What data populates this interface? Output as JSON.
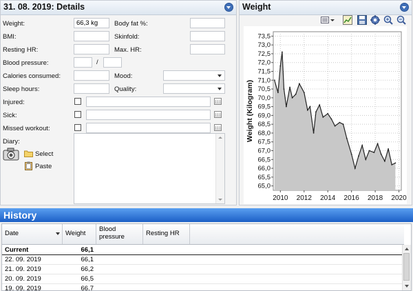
{
  "details": {
    "title": "31. 08. 2019: Details",
    "weight_label": "Weight:",
    "weight_value": "66,3 kg",
    "body_fat_label": "Body fat %:",
    "bmi_label": "BMI:",
    "skinfold_label": "Skinfold:",
    "resting_hr_label": "Resting HR:",
    "max_hr_label": "Max. HR:",
    "blood_pressure_label": "Blood pressure:",
    "bp_separator": "/",
    "calories_label": "Calories consumed:",
    "mood_label": "Mood:",
    "sleep_label": "Sleep hours:",
    "quality_label": "Quality:",
    "injured_label": "Injured:",
    "sick_label": "Sick:",
    "missed_label": "Missed workout:",
    "diary_label": "Diary:",
    "select_label": "Select",
    "paste_label": "Paste"
  },
  "weight_panel": {
    "title": "Weight"
  },
  "chart_data": {
    "type": "area",
    "ylabel": "Weight (Kilogram)",
    "xlabel": "",
    "xticks": [
      "2010",
      "2012",
      "2014",
      "2016",
      "2018",
      "2020"
    ],
    "yticks": [
      "73,5",
      "73,0",
      "72,5",
      "72,0",
      "71,5",
      "71,0",
      "70,5",
      "70,0",
      "69,5",
      "69,0",
      "68,5",
      "68,0",
      "67,5",
      "67,0",
      "66,5",
      "66,0",
      "65,5",
      "65,0"
    ],
    "xlim": [
      2009.4,
      2020.2
    ],
    "ylim": [
      64.75,
      73.75
    ],
    "grid": true,
    "x": [
      2009.5,
      2009.8,
      2010.0,
      2010.15,
      2010.3,
      2010.5,
      2010.8,
      2011.0,
      2011.3,
      2011.6,
      2012.0,
      2012.3,
      2012.5,
      2012.8,
      2013.0,
      2013.3,
      2013.6,
      2014.0,
      2014.3,
      2014.6,
      2015.0,
      2015.3,
      2015.6,
      2016.0,
      2016.3,
      2016.6,
      2016.9,
      2017.2,
      2017.5,
      2017.9,
      2018.2,
      2018.5,
      2018.8,
      2019.1,
      2019.4,
      2019.7
    ],
    "values": [
      71.0,
      70.3,
      71.8,
      72.6,
      70.5,
      69.5,
      70.6,
      70.0,
      70.2,
      70.8,
      70.3,
      69.3,
      69.5,
      68.0,
      69.2,
      69.6,
      68.9,
      69.1,
      68.8,
      68.4,
      68.6,
      68.5,
      67.7,
      66.8,
      66.0,
      66.7,
      67.3,
      66.5,
      67.0,
      66.9,
      67.4,
      66.8,
      66.4,
      67.1,
      66.2,
      66.3
    ]
  },
  "history": {
    "title": "History",
    "columns": [
      "Date",
      "Weight",
      "Blood pressure",
      "Resting HR"
    ],
    "current_label": "Current",
    "current_weight": "66,1",
    "rows": [
      {
        "date": "22. 09. 2019",
        "weight": "66,1"
      },
      {
        "date": "21. 09. 2019",
        "weight": "66,2"
      },
      {
        "date": "20. 09. 2019",
        "weight": "66,5"
      },
      {
        "date": "19. 09. 2019",
        "weight": "66,7"
      }
    ]
  },
  "colors": {
    "accent": "#1c5fc6",
    "chart_fill": "#c8c8c8",
    "chart_line": "#222222"
  }
}
